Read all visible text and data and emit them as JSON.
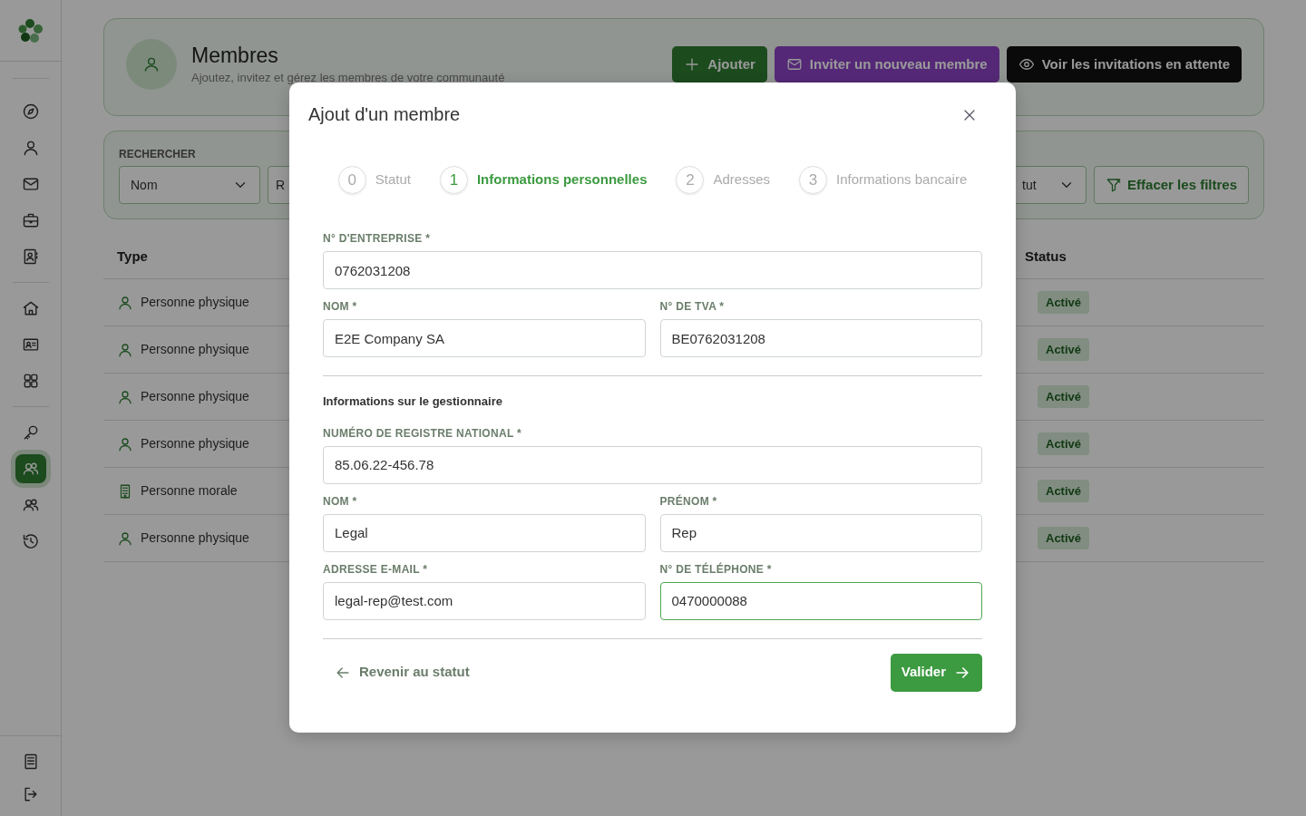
{
  "sidebar": {
    "groups": [
      {
        "items": [
          {
            "selected": false
          },
          {
            "selected": false
          },
          {
            "selected": false
          },
          {
            "selected": false
          },
          {
            "selected": false
          }
        ]
      },
      {
        "items": [
          {
            "selected": false
          },
          {
            "selected": false
          },
          {
            "selected": false
          }
        ]
      },
      {
        "items": [
          {
            "selected": false
          },
          {
            "selected": true
          },
          {
            "selected": false
          },
          {
            "selected": false
          }
        ]
      }
    ],
    "bottom_items": [
      {
        "selected": false
      },
      {
        "selected": false
      }
    ]
  },
  "header": {
    "title": "Membres",
    "subtitle": "Ajoutez, invitez et gérez les membres de votre communauté",
    "buttons": [
      {
        "label": "Ajouter",
        "kind": "add"
      },
      {
        "label": "Inviter un nouveau membre",
        "kind": "invite"
      },
      {
        "label": "Voir les invitations en attente",
        "kind": "pending"
      }
    ]
  },
  "filters": {
    "label": "RECHERCHER",
    "search_by": "Nom",
    "search_field": "R",
    "status_select": "tut",
    "clear": "Effacer les filtres"
  },
  "table": {
    "columns": [
      "Type",
      "Status"
    ],
    "rows": [
      {
        "type": "Personne physique",
        "kind": "person",
        "status": "Activé"
      },
      {
        "type": "Personne physique",
        "kind": "person",
        "status": "Activé"
      },
      {
        "type": "Personne physique",
        "kind": "person",
        "status": "Activé"
      },
      {
        "type": "Personne physique",
        "kind": "person",
        "status": "Activé"
      },
      {
        "type": "Personne morale",
        "kind": "company",
        "status": "Activé"
      },
      {
        "type": "Personne physique",
        "kind": "person",
        "status": "Activé"
      }
    ]
  },
  "modal": {
    "title": "Ajout d'un membre",
    "steps": [
      {
        "number": "0",
        "label": "Statut",
        "selected": false
      },
      {
        "number": "1",
        "label": "Informations personnelles",
        "selected": true
      },
      {
        "number": "2",
        "label": "Adresses",
        "selected": false
      },
      {
        "number": "3",
        "label": "Informations bancaire",
        "selected": false
      }
    ],
    "company_fields": [
      [
        {
          "label": "N° D'ENTREPRISE *",
          "value": "0762031208",
          "focused": false
        }
      ],
      [
        {
          "label": "NOM *",
          "value": "E2E Company SA",
          "focused": false
        },
        {
          "label": "N° DE TVA *",
          "value": "BE0762031208",
          "focused": false
        }
      ]
    ],
    "manager_section": {
      "title": "Informations sur le gestionnaire",
      "fields": [
        [
          {
            "label": "NUMÉRO DE REGISTRE NATIONAL *",
            "value": "85.06.22-456.78",
            "focused": false
          }
        ],
        [
          {
            "label": "NOM *",
            "value": "Legal",
            "focused": false
          },
          {
            "label": "PRÉNOM *",
            "value": "Rep",
            "focused": false
          }
        ],
        [
          {
            "label": "ADRESSE E-MAIL *",
            "value": "legal-rep@test.com",
            "focused": false
          },
          {
            "label": "N° DE TÉLÉPHONE *",
            "value": "0470000088",
            "focused": true
          }
        ]
      ]
    },
    "back_link": "Revenir au statut",
    "submit": "Valider"
  }
}
